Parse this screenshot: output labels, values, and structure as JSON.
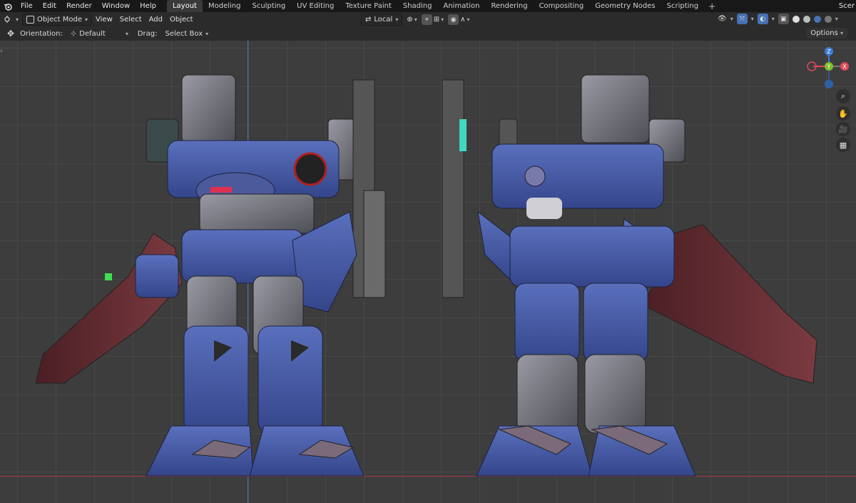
{
  "menu": [
    "File",
    "Edit",
    "Render",
    "Window",
    "Help"
  ],
  "workspaces": [
    "Layout",
    "Modeling",
    "Sculpting",
    "UV Editing",
    "Texture Paint",
    "Shading",
    "Animation",
    "Rendering",
    "Compositing",
    "Geometry Nodes",
    "Scripting"
  ],
  "active_workspace": "Layout",
  "scene_label": "Scer",
  "header": {
    "mode": "Object Mode",
    "view": "View",
    "select": "Select",
    "add": "Add",
    "object": "Object",
    "pivot": "Local"
  },
  "toolrow": {
    "orientation_label": "Orientation:",
    "orientation_value": "Default",
    "drag_label": "Drag:",
    "drag_value": "Select Box",
    "options": "Options"
  },
  "gizmo": {
    "x": "X",
    "y": "Y",
    "z": "Z"
  },
  "colors": {
    "x_axis": "#e04a5a",
    "y_axis": "#7fbf2a",
    "z_axis": "#3b7bd6",
    "mech_blue": "#4a5fa8",
    "mech_grey": "#6a6a72",
    "weapon_red": "#6a2a2e"
  },
  "icons": [
    "blender-logo-icon",
    "move-tool-icon",
    "zoom-icon",
    "hand-icon",
    "camera-icon",
    "grid-icon"
  ]
}
